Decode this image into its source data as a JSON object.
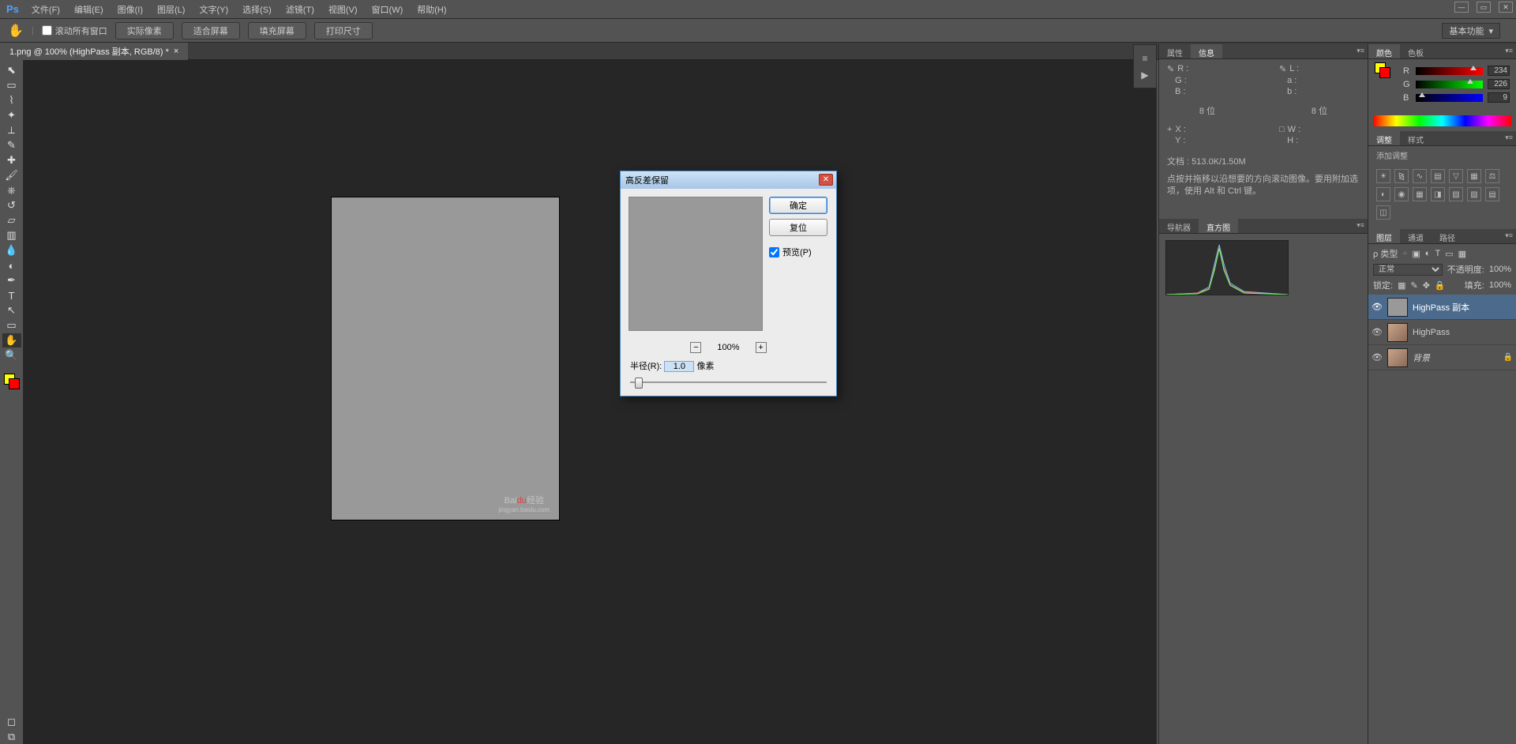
{
  "menubar": {
    "items": [
      "文件(F)",
      "编辑(E)",
      "图像(I)",
      "图层(L)",
      "文字(Y)",
      "选择(S)",
      "滤镜(T)",
      "视图(V)",
      "窗口(W)",
      "帮助(H)"
    ]
  },
  "workspace_label": "基本功能",
  "optionsbar": {
    "scroll_all_windows": "滚动所有窗口",
    "actual_pixels": "实际像素",
    "fit_screen": "适合屏幕",
    "fill_screen": "填充屏幕",
    "print_size": "打印尺寸"
  },
  "document_tab": {
    "label": "1.png @ 100% (HighPass 副本, RGB/8) *"
  },
  "watermark": {
    "line1": "Bai",
    "highlight": "du",
    "line2": "经验",
    "sub": "jingyan.baidu.com"
  },
  "info_panel": {
    "tabs": [
      "属性",
      "信息"
    ],
    "rgb": {
      "R": "R :",
      "G": "G :",
      "B": "B :"
    },
    "lab": {
      "L": "L :",
      "a": "a :",
      "b": "b :"
    },
    "bit1": "8 位",
    "bit2": "8 位",
    "xy": {
      "X": "X :",
      "Y": "Y :"
    },
    "wh": {
      "W": "W :",
      "H": "H :"
    },
    "doc": "文档 : 513.0K/1.50M",
    "hint": "点按并拖移以沿想要的方向滚动图像。要用附加选项，使用 Alt 和 Ctrl 键。"
  },
  "nav_panel": {
    "tabs": [
      "导航器",
      "直方图"
    ]
  },
  "color_panel": {
    "tabs": [
      "颜色",
      "色板"
    ],
    "r_label": "R",
    "g_label": "G",
    "b_label": "B",
    "r_val": "234",
    "g_val": "226",
    "b_val": "9"
  },
  "adjust_panel": {
    "tabs": [
      "调整",
      "样式"
    ],
    "title": "添加调整"
  },
  "layers_panel": {
    "tabs": [
      "图层",
      "通道",
      "路径"
    ],
    "filter_label": "ρ 类型",
    "blend_mode": "正常",
    "opacity_label": "不透明度:",
    "opacity_val": "100%",
    "lock_label": "锁定:",
    "fill_label": "填充:",
    "fill_val": "100%",
    "layers": [
      {
        "name": "HighPass 副本",
        "active": true
      },
      {
        "name": "HighPass",
        "active": false
      },
      {
        "name": "背景",
        "active": false,
        "locked": true
      }
    ]
  },
  "dialog": {
    "title": "高反差保留",
    "ok": "确定",
    "reset": "复位",
    "preview": "预览(P)",
    "zoom": "100%",
    "radius_label": "半径(R):",
    "radius_value": "1.0",
    "radius_unit": "像素"
  }
}
